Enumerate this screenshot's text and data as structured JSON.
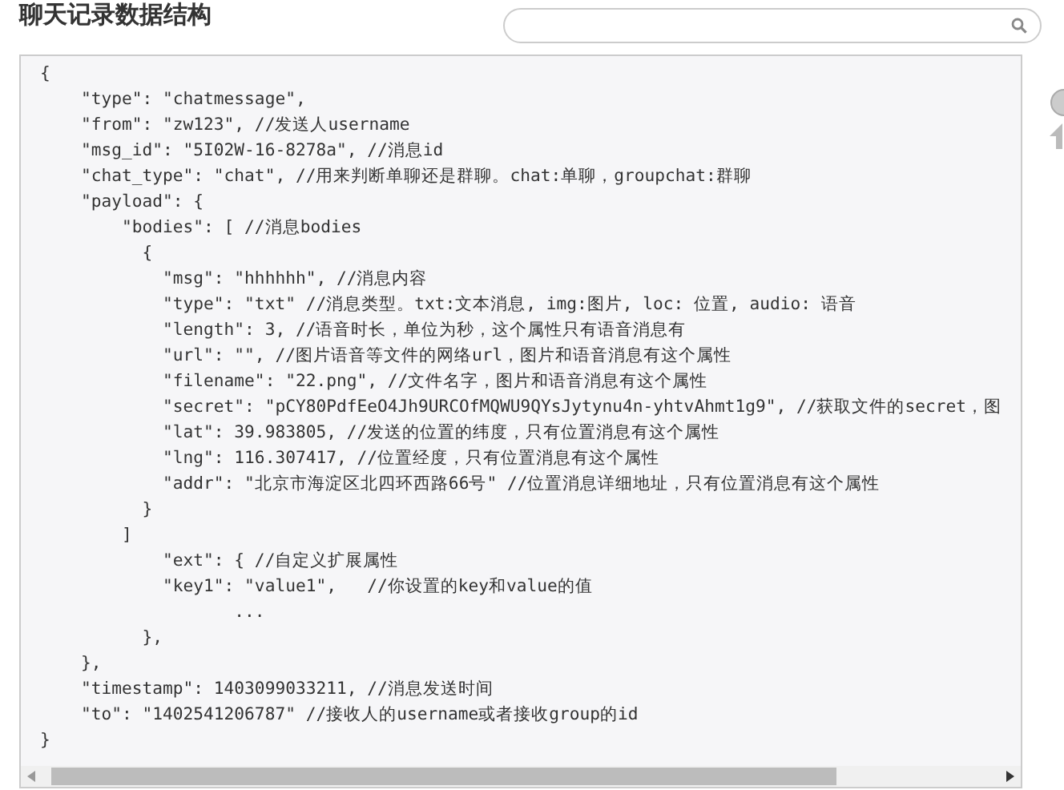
{
  "title": "聊天记录数据结构",
  "code_lines": [
    "{",
    "    \"type\": \"chatmessage\",",
    "    \"from\": \"zw123\", //发送人username",
    "    \"msg_id\": \"5I02W-16-8278a\", //消息id",
    "    \"chat_type\": \"chat\", //用来判断单聊还是群聊。chat:单聊，groupchat:群聊",
    "    \"payload\": {",
    "        \"bodies\": [ //消息bodies",
    "          {",
    "            \"msg\": \"hhhhhh\", //消息内容",
    "            \"type\": \"txt\" //消息类型。txt:文本消息, img:图片, loc: 位置, audio: 语音",
    "            \"length\": 3, //语音时长，单位为秒，这个属性只有语音消息有",
    "            \"url\": \"\", //图片语音等文件的网络url，图片和语音消息有这个属性",
    "            \"filename\": \"22.png\", //文件名字，图片和语音消息有这个属性",
    "            \"secret\": \"pCY80PdfEeO4Jh9URCOfMQWU9QYsJytynu4n-yhtvAhmt1g9\", //获取文件的secret，图",
    "            \"lat\": 39.983805, //发送的位置的纬度，只有位置消息有这个属性",
    "            \"lng\": 116.307417, //位置经度，只有位置消息有这个属性",
    "            \"addr\": \"北京市海淀区北四环西路66号\" //位置消息详细地址，只有位置消息有这个属性",
    "          }",
    "        ]",
    "            \"ext\": { //自定义扩展属性",
    "            \"key1\": \"value1\",   //你设置的key和value的值",
    "                   ...",
    "          },",
    "    },",
    "    \"timestamp\": 1403099033211, //消息发送时间",
    "    \"to\": \"1402541206787\" //接收人的username或者接收group的id",
    "}"
  ]
}
